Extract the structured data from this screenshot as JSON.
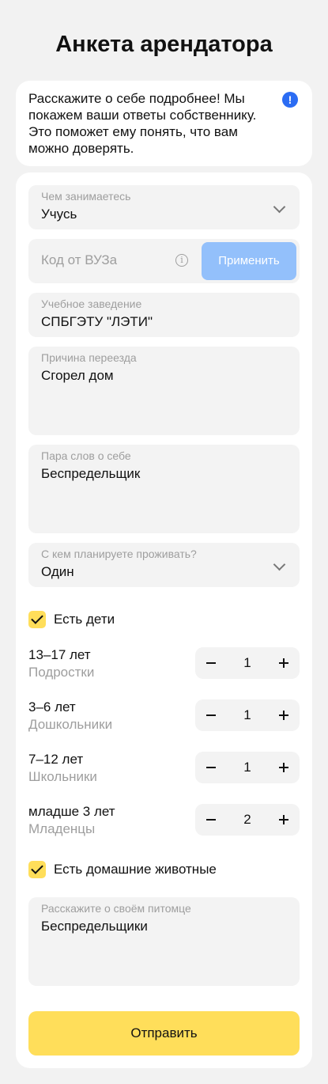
{
  "page": {
    "title": "Анкета арендатора"
  },
  "info": {
    "text": "Расскажите о себе подробнее! Мы покажем ваши ответы собственнику. Это поможет ему понять, что вам можно доверять.",
    "icon": "exclamation-icon",
    "icon_glyph": "!"
  },
  "form": {
    "occupation": {
      "label": "Чем занимаетесь",
      "value": "Учусь"
    },
    "promo": {
      "placeholder": "Код от ВУЗа",
      "hint_glyph": "i",
      "apply_label": "Применить"
    },
    "institution": {
      "label": "Учебное заведение",
      "value": "СПБГЭТУ \"ЛЭТИ\""
    },
    "reason": {
      "label": "Причина переезда",
      "value": "Сгорел дом"
    },
    "about": {
      "label": "Пара слов о себе",
      "value": "Беспредельщик"
    },
    "cohabit": {
      "label": "С кем планируете проживать?",
      "value": "Один"
    },
    "has_children": {
      "label": "Есть дети",
      "checked": true
    },
    "children": [
      {
        "age": "13–17 лет",
        "category": "Подростки",
        "count": "1"
      },
      {
        "age": "3–6 лет",
        "category": "Дошкольники",
        "count": "1"
      },
      {
        "age": "7–12 лет",
        "category": "Школьники",
        "count": "1"
      },
      {
        "age": "младше 3 лет",
        "category": "Младенцы",
        "count": "2"
      }
    ],
    "has_pets": {
      "label": "Есть домашние животные",
      "checked": true
    },
    "pet": {
      "label": "Расскажите о своём питомце",
      "value": "Беспредельщики"
    },
    "submit_label": "Отправить"
  },
  "colors": {
    "accent_yellow": "#ffde5a",
    "apply_button_disabled": "#93c0fb",
    "info_icon": "#2b6cf3",
    "field_bg": "#f3f3f3",
    "page_bg": "#f2f2f2"
  }
}
